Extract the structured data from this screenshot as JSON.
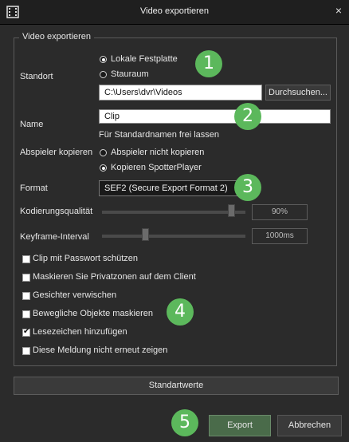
{
  "window": {
    "title": "Video exportieren",
    "close_icon": "close-icon"
  },
  "group": {
    "legend": "Video exportieren"
  },
  "standort": {
    "label": "Standort",
    "options": [
      "Lokale Festplatte",
      "Stauraum"
    ],
    "selected_index": 0,
    "path_value": "C:\\Users\\dvr\\Videos",
    "browse_label": "Durchsuchen..."
  },
  "name": {
    "label": "Name",
    "value": "Clip",
    "hint": "Für Standardnamen frei lassen"
  },
  "player": {
    "label": "Abspieler kopieren",
    "options": [
      "Abspieler nicht kopieren",
      "Kopieren SpotterPlayer"
    ],
    "selected_index": 1
  },
  "format": {
    "label": "Format",
    "selected": "SEF2 (Secure Export Format 2)"
  },
  "quality": {
    "label": "Kodierungsqualität",
    "readout": "90%",
    "value_fraction": 0.9
  },
  "keyframe": {
    "label": "Keyframe-Interval",
    "readout": "1000ms",
    "value_fraction": 0.3
  },
  "checkboxes": [
    {
      "label": "Clip mit Passwort schützen",
      "checked": false
    },
    {
      "label": "Maskieren Sie Privatzonen auf dem Client",
      "checked": false
    },
    {
      "label": "Gesichter verwischen",
      "checked": false
    },
    {
      "label": "Bewegliche Objekte maskieren",
      "checked": false
    },
    {
      "label": "Lesezeichen hinzufügen",
      "checked": true
    },
    {
      "label": "Diese Meldung nicht erneut zeigen",
      "checked": false
    }
  ],
  "buttons": {
    "defaults_label": "Standartwerte",
    "export_label": "Export",
    "cancel_label": "Abbrechen"
  },
  "badges": [
    "1",
    "2",
    "3",
    "4",
    "5"
  ],
  "colors": {
    "badge": "#5cb85c",
    "background": "#2b2b2b",
    "export_button": "#4a6b4a"
  }
}
